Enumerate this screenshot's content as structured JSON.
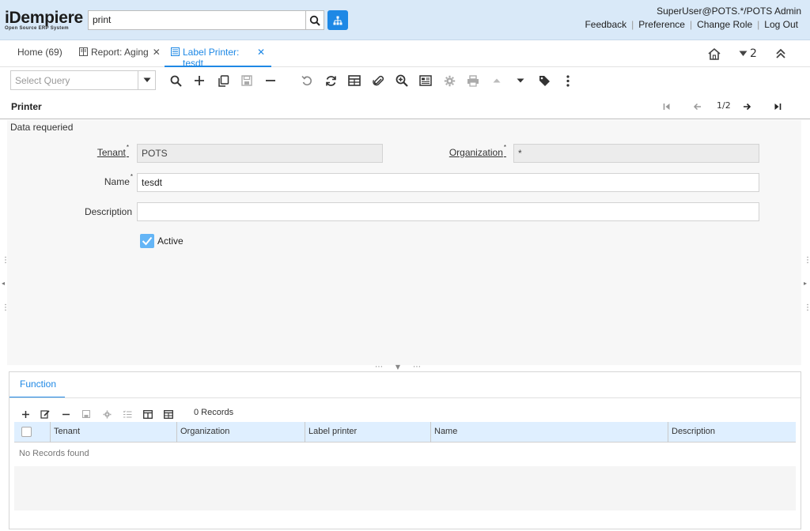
{
  "header": {
    "logo_main": "iDempiere",
    "logo_sub": "Open Source ERP System",
    "search_value": "print",
    "user": "SuperUser@POTS.*/POTS Admin",
    "links": [
      "Feedback",
      "Preference",
      "Change Role",
      "Log Out"
    ]
  },
  "tabs": [
    {
      "label": "Home (69)"
    },
    {
      "label": "Report: Aging"
    },
    {
      "label": "Label Printer: tesdt"
    }
  ],
  "tabbar": {
    "window_count": "2"
  },
  "toolbar": {
    "query_placeholder": "Select Query"
  },
  "panel": {
    "title": "Printer",
    "record_nav": "1/2",
    "status": "Data requeried"
  },
  "form": {
    "tenant_label": "Tenant",
    "tenant_value": "POTS",
    "org_label": "Organization",
    "org_value": "*",
    "name_label": "Name",
    "name_value": "tesdt",
    "description_label": "Description",
    "description_value": "",
    "active_label": "Active",
    "required_mark": "*"
  },
  "detail": {
    "tab_label": "Function",
    "records": "0 Records",
    "columns": [
      "Tenant",
      "Organization",
      "Label printer",
      "Name",
      "Description"
    ],
    "empty_message": "No Records found"
  },
  "colors": {
    "accent": "#1e88e5",
    "header_bg": "#d9e9f8"
  }
}
